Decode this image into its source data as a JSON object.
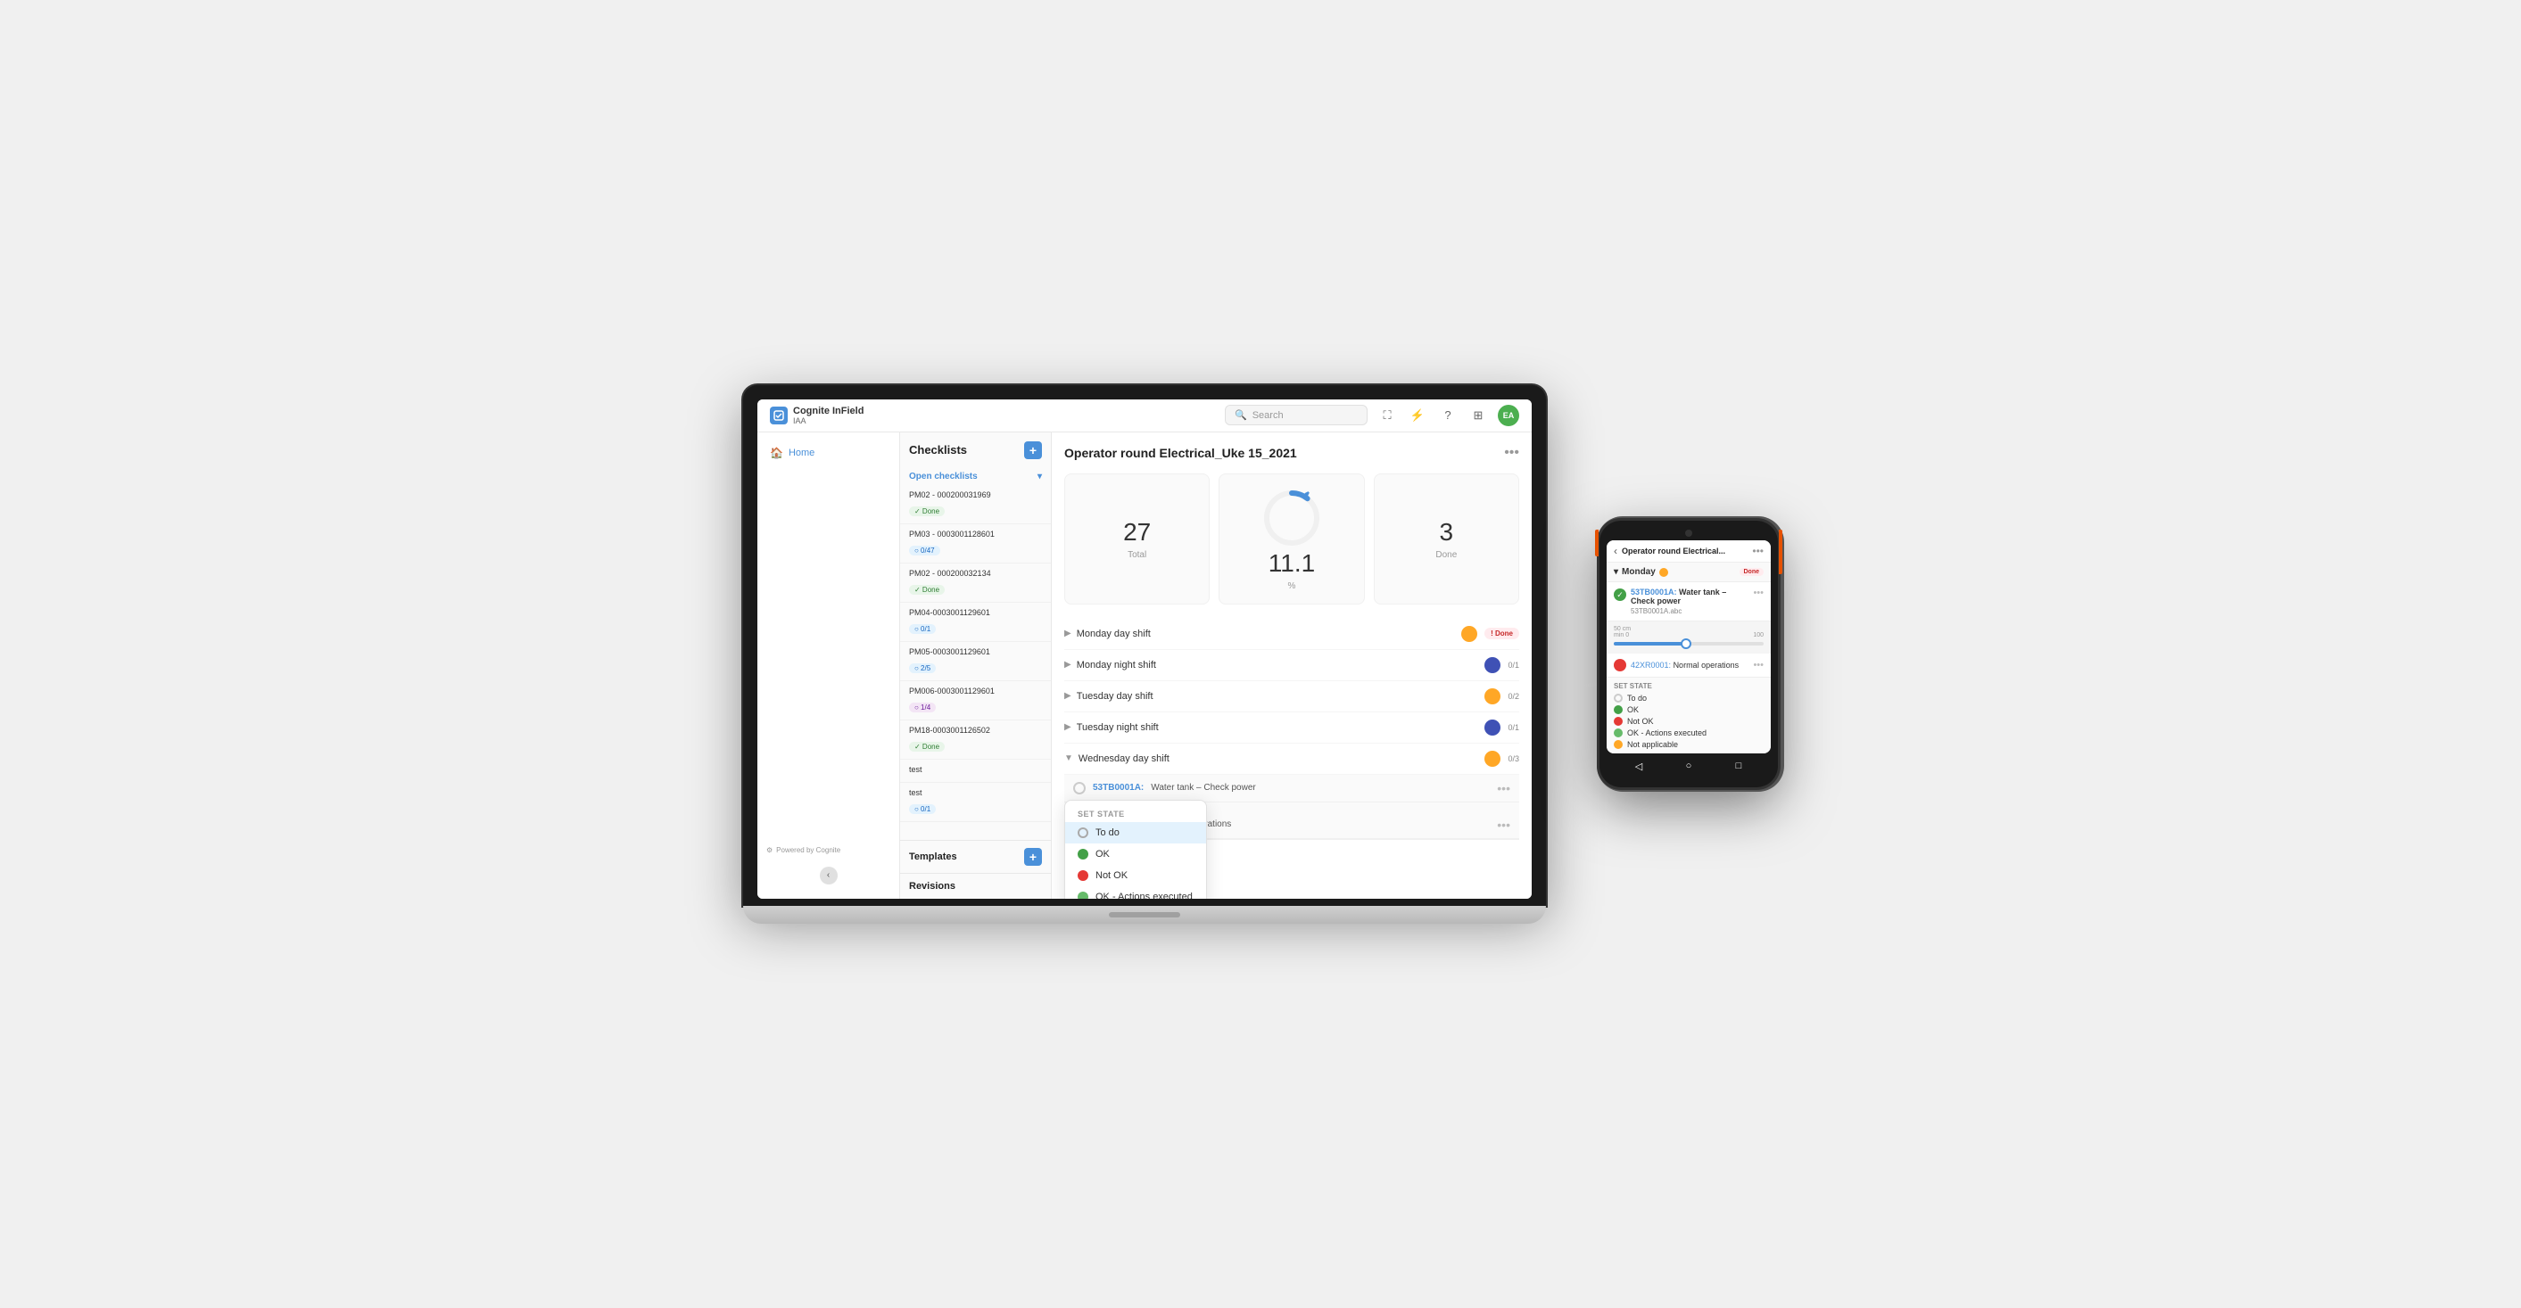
{
  "app": {
    "name": "Cognite InField",
    "org": "IAA",
    "search_placeholder": "Search"
  },
  "nav": {
    "home_label": "Home"
  },
  "checklists": {
    "panel_title": "Checklists",
    "section_open": "Open checklists",
    "items": [
      {
        "id": "PM02-000200031969",
        "badge": "Done",
        "badge_type": "done"
      },
      {
        "id": "PM03-0003001128601",
        "badge": "0/47",
        "badge_type": "progress"
      },
      {
        "id": "PM02-000200032134",
        "badge": "Done",
        "badge_type": "done"
      },
      {
        "id": "PM04-0003001129601",
        "badge": "0/1",
        "badge_type": "progress"
      },
      {
        "id": "PM05-0003001129601",
        "badge": "2/5",
        "badge_type": "progress"
      },
      {
        "id": "PM006-0003001129601",
        "badge": "1/4",
        "badge_type": "fraction"
      },
      {
        "id": "PM18-0003001126502",
        "badge": "Done",
        "badge_type": "done"
      },
      {
        "id": "test",
        "badge": "",
        "badge_type": "none"
      },
      {
        "id": "test",
        "badge": "0/1",
        "badge_type": "progress"
      }
    ],
    "templates_label": "Templates",
    "revisions_label": "Revisions",
    "powered_by": "Powered by Cognite"
  },
  "content": {
    "title": "Operator round Electrical_Uke 15_2021",
    "stats": {
      "total": "27",
      "total_label": "Total",
      "percent": "11.1",
      "percent_label": "%",
      "done": "3",
      "done_label": "Done"
    },
    "shifts": [
      {
        "name": "Monday day shift",
        "expanded": false,
        "user_color": "#ffa726",
        "status": "Done",
        "status_type": "done"
      },
      {
        "name": "Monday night shift",
        "expanded": false,
        "user_color": "#3f51b5",
        "status": "0/1",
        "status_type": "fraction"
      },
      {
        "name": "Tuesday day shift",
        "expanded": false,
        "user_color": "#ffa726",
        "status": "0/2",
        "status_type": "fraction"
      },
      {
        "name": "Tuesday night shift",
        "expanded": false,
        "user_color": "#3f51b5",
        "status": "0/1",
        "status_type": "fraction"
      },
      {
        "name": "Wednesday day shift",
        "expanded": true,
        "user_color": "#ffa726",
        "status": "0/3",
        "status_type": "fraction"
      }
    ],
    "tasks": [
      {
        "id": "53TB0001A",
        "description": "Water tank – Check power",
        "link_color": "#4a90d9"
      },
      {
        "id": "(2) 42XR0001",
        "description": "Normal operations",
        "link_color": "#4a90d9"
      }
    ],
    "set_state": {
      "label": "SET STATE",
      "options": [
        {
          "label": "To do",
          "type": "empty",
          "selected": true
        },
        {
          "label": "OK",
          "type": "green",
          "selected": false
        },
        {
          "label": "Not OK",
          "type": "red",
          "selected": false
        },
        {
          "label": "OK - Actions executed",
          "type": "green-action",
          "selected": false
        },
        {
          "label": "Not applicable",
          "type": "yellow",
          "selected": false
        }
      ]
    }
  },
  "phone": {
    "title": "Operator round Electrical...",
    "section": "Monday",
    "section_badge": "Done",
    "task1": {
      "id": "53TB0001A",
      "title": "Water tank – Check power",
      "sub": "53TB0001A.abc",
      "slider_min": "0",
      "slider_max": "100",
      "slider_label": "50 cm"
    },
    "task2": {
      "id": "42XR0001",
      "title": "Normal operations"
    },
    "set_state": {
      "label": "SET STATE",
      "options": [
        {
          "label": "To do",
          "type": "radio-empty"
        },
        {
          "label": "OK",
          "type": "radio-selected"
        },
        {
          "label": "Not OK",
          "type": "radio-red"
        },
        {
          "label": "OK - Actions executed",
          "type": "radio-green"
        },
        {
          "label": "Not applicable",
          "type": "radio-yellow"
        }
      ]
    }
  }
}
